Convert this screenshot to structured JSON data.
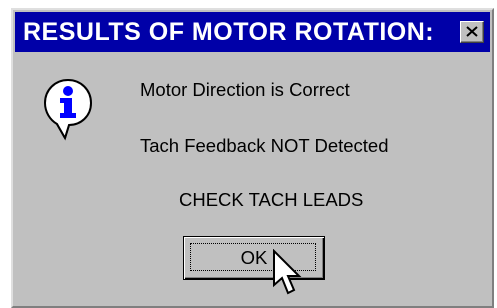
{
  "dialog": {
    "title": "RESULTS OF MOTOR ROTATION:",
    "close_icon": "close-icon",
    "icon": "info-icon",
    "messages": [
      "Motor Direction is Correct",
      "Tach Feedback NOT Detected",
      "CHECK TACH LEADS"
    ],
    "ok_label": "OK"
  },
  "colors": {
    "titlebar": "#0000a8",
    "face": "#c0c0c0",
    "icon_blue": "#0000ff"
  },
  "cursor_icon": "arrow-pointer-icon"
}
